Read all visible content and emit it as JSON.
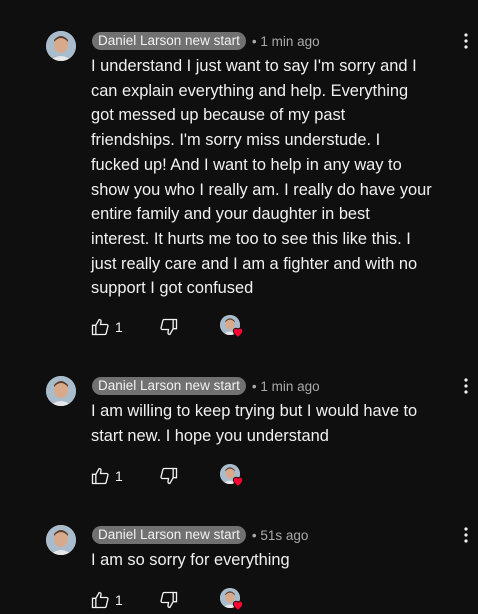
{
  "comments": [
    {
      "author": "Daniel Larson new start",
      "time": "1 min ago",
      "text": "I understand I just want to say I'm sorry and I\ncan explain everything and help. Everything\ngot messed up because of my past\nfriendships. I'm sorry miss understude. I\nfucked up! And I want to help in any way to\nshow you who I really am. I really do have your\nentire family and your daughter in best\ninterest. It hurts me too to see this like this. I\njust really care and I am a fighter and with no\nsupport I got confused",
      "likes": "1"
    },
    {
      "author": "Daniel Larson new start",
      "time": "1 min ago",
      "text": "I am willing to keep trying but I would have to\nstart new. I hope you understand",
      "likes": "1"
    },
    {
      "author": "Daniel Larson new start",
      "time": "51s ago",
      "text": "I am so sorry for everything",
      "likes": "1"
    }
  ],
  "meta_separator": "•",
  "colors": {
    "background": "#0f0f0f",
    "name_chip": "#717171",
    "heart": "#ff0033"
  }
}
